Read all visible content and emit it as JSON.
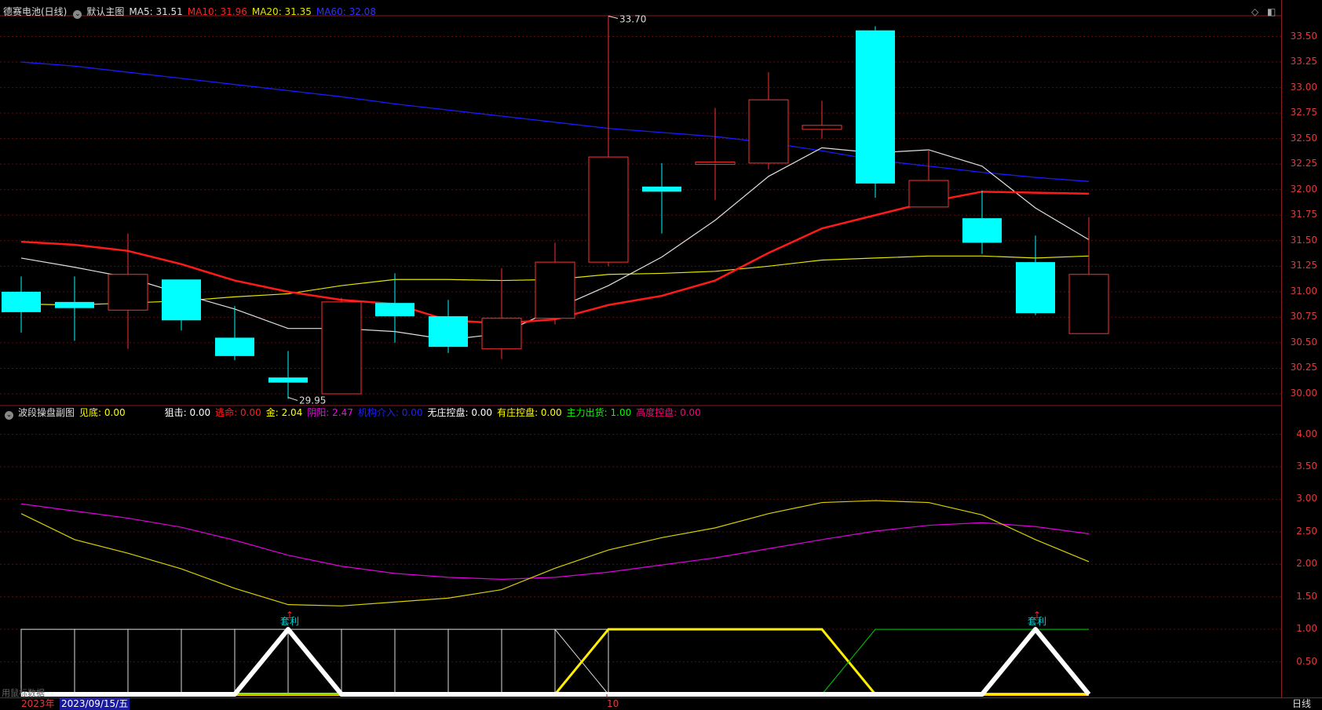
{
  "main_header": {
    "title": "德赛电池(日线)",
    "template": "默认主图",
    "ma5": "MA5: 31.51",
    "ma10": "MA10: 31.96",
    "ma20": "MA20: 31.35",
    "ma60": "MA60: 32.08"
  },
  "sub_header": {
    "title": "波段操盘副图",
    "items": [
      {
        "text": "见底: 0.00",
        "color": "#ffff00"
      },
      {
        "text": "狙击: 0.00",
        "color": "#ffffff"
      },
      {
        "text": "逃命: 0.00",
        "color": "#ff2020"
      },
      {
        "text": "金: 2.04",
        "color": "#ffff00"
      },
      {
        "text": "阴阳: 2.47",
        "color": "#ff00ff"
      },
      {
        "text": "机构介入: 0.00",
        "color": "#2020ff"
      },
      {
        "text": "无庄控盘: 0.00",
        "color": "#ffffff"
      },
      {
        "text": "有庄控盘: 0.00",
        "color": "#ffff00"
      },
      {
        "text": "主力出货: 1.00",
        "color": "#00ff00"
      },
      {
        "text": "高度控盘: 0.00",
        "color": "#ff0080"
      }
    ]
  },
  "colors": {
    "up": "#ff3030",
    "down": "#00ffff",
    "ma5": "#e0e0e0",
    "ma10": "#ff1a1a",
    "ma20": "#e6e600",
    "ma60": "#1a1aff",
    "grid": "#5a0f0f"
  },
  "price_axis_labels": [
    "33.50",
    "33.25",
    "33.00",
    "32.75",
    "32.50",
    "32.25",
    "32.00",
    "31.75",
    "31.50",
    "31.25",
    "31.00",
    "30.75",
    "30.50",
    "30.25",
    "30.00"
  ],
  "sub_axis_labels": [
    "4.00",
    "3.50",
    "3.00",
    "2.50",
    "2.00",
    "1.50",
    "1.00",
    "0.50"
  ],
  "annotations": {
    "high": "33.70",
    "low": "29.95",
    "arbitrage1": "套利",
    "arbitrage2": "套利"
  },
  "bottom": {
    "year": "2023年",
    "date": "2023/09/15/五",
    "month": "10",
    "period": "日线",
    "hint": "用鼠标数据"
  },
  "chart_data": {
    "type": "candlestick",
    "price_range": [
      29.9,
      33.65
    ],
    "candles": [
      {
        "o": 31.0,
        "h": 31.15,
        "l": 30.6,
        "c": 30.8
      },
      {
        "o": 30.9,
        "h": 31.15,
        "l": 30.52,
        "c": 30.84
      },
      {
        "o": 30.82,
        "h": 31.57,
        "l": 30.44,
        "c": 31.17
      },
      {
        "o": 31.12,
        "h": 31.12,
        "l": 30.62,
        "c": 30.72
      },
      {
        "o": 30.55,
        "h": 30.86,
        "l": 30.33,
        "c": 30.37
      },
      {
        "o": 30.16,
        "h": 30.42,
        "l": 29.95,
        "c": 30.11
      },
      {
        "o": 30.0,
        "h": 30.94,
        "l": 30.0,
        "c": 30.9
      },
      {
        "o": 30.89,
        "h": 31.18,
        "l": 30.5,
        "c": 30.76
      },
      {
        "o": 30.76,
        "h": 30.92,
        "l": 30.4,
        "c": 30.46
      },
      {
        "o": 30.44,
        "h": 31.23,
        "l": 30.34,
        "c": 30.74
      },
      {
        "o": 30.74,
        "h": 31.48,
        "l": 30.68,
        "c": 31.29
      },
      {
        "o": 31.29,
        "h": 33.7,
        "l": 31.25,
        "c": 32.32
      },
      {
        "o": 32.03,
        "h": 32.26,
        "l": 31.57,
        "c": 31.98
      },
      {
        "o": 32.27,
        "h": 32.8,
        "l": 31.9,
        "c": 32.27
      },
      {
        "o": 32.26,
        "h": 33.15,
        "l": 32.2,
        "c": 32.88
      },
      {
        "o": 32.59,
        "h": 32.87,
        "l": 32.5,
        "c": 32.63
      },
      {
        "o": 33.56,
        "h": 33.6,
        "l": 31.92,
        "c": 32.06
      },
      {
        "o": 31.83,
        "h": 32.39,
        "l": 31.83,
        "c": 32.09
      },
      {
        "o": 31.72,
        "h": 31.99,
        "l": 31.37,
        "c": 31.48
      },
      {
        "o": 31.29,
        "h": 31.55,
        "l": 30.77,
        "c": 30.79
      },
      {
        "o": 30.59,
        "h": 31.73,
        "l": 30.59,
        "c": 31.17
      }
    ],
    "ma5": [
      31.33,
      31.24,
      31.14,
      30.98,
      30.83,
      30.64,
      30.64,
      30.61,
      30.53,
      30.59,
      30.83,
      31.06,
      31.34,
      31.7,
      32.13,
      32.41,
      32.36,
      32.39,
      32.23,
      31.82,
      31.51
    ],
    "ma10": [
      31.49,
      31.46,
      31.4,
      31.27,
      31.11,
      31.0,
      30.92,
      30.88,
      30.72,
      30.69,
      30.73,
      30.87,
      30.96,
      31.11,
      31.38,
      31.62,
      31.75,
      31.88,
      31.98,
      31.97,
      31.96
    ],
    "ma20": [
      30.88,
      30.87,
      30.89,
      30.91,
      30.95,
      30.98,
      31.06,
      31.12,
      31.12,
      31.11,
      31.12,
      31.17,
      31.18,
      31.2,
      31.25,
      31.31,
      31.33,
      31.35,
      31.35,
      31.33,
      31.35
    ],
    "ma60": [
      33.25,
      33.21,
      33.15,
      33.09,
      33.03,
      32.97,
      32.91,
      32.84,
      32.78,
      32.72,
      32.66,
      32.6,
      32.56,
      32.52,
      32.46,
      32.38,
      32.29,
      32.23,
      32.17,
      32.12,
      32.08
    ],
    "sub_range": [
      0,
      4.2
    ],
    "gold": [
      2.78,
      2.38,
      2.17,
      1.93,
      1.63,
      1.38,
      1.36,
      1.42,
      1.48,
      1.61,
      1.94,
      2.22,
      2.41,
      2.56,
      2.78,
      2.95,
      2.98,
      2.95,
      2.76,
      2.38,
      2.04
    ],
    "yinyang": [
      2.93,
      2.82,
      2.71,
      2.57,
      2.37,
      2.14,
      1.97,
      1.86,
      1.8,
      1.77,
      1.8,
      1.88,
      1.99,
      2.1,
      2.24,
      2.38,
      2.51,
      2.6,
      2.64,
      2.58,
      2.47
    ],
    "white_zigzag": [
      0,
      0,
      0,
      0,
      0,
      1,
      0,
      0,
      0,
      0,
      0,
      0,
      0,
      0,
      0,
      0,
      0,
      0,
      0,
      1,
      0
    ],
    "yellow_band": [
      0,
      0,
      0,
      0,
      0,
      0,
      0,
      0,
      0,
      0,
      0,
      1,
      1,
      1,
      1,
      1,
      0,
      0,
      0,
      0,
      0
    ],
    "green_line": [
      0,
      0,
      0,
      0,
      0,
      0,
      0,
      0,
      0,
      0,
      0,
      0,
      0,
      0,
      0,
      0,
      1,
      1,
      1,
      1,
      1
    ],
    "wireframe_bars": [
      1,
      1,
      1,
      1,
      1,
      1,
      1,
      1,
      1,
      1,
      1,
      0,
      0,
      0,
      0,
      0,
      0,
      0,
      0,
      0,
      0
    ]
  }
}
